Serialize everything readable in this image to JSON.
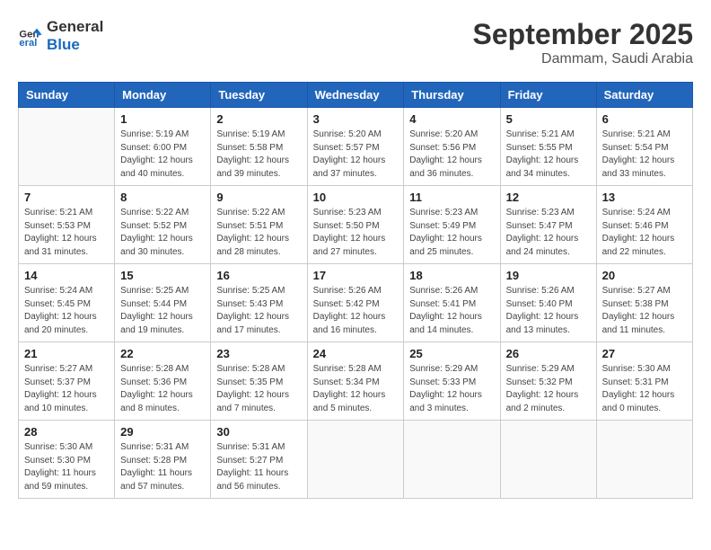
{
  "header": {
    "logo_line1": "General",
    "logo_line2": "Blue",
    "month": "September 2025",
    "location": "Dammam, Saudi Arabia"
  },
  "days_of_week": [
    "Sunday",
    "Monday",
    "Tuesday",
    "Wednesday",
    "Thursday",
    "Friday",
    "Saturday"
  ],
  "weeks": [
    [
      {
        "day": "",
        "info": ""
      },
      {
        "day": "1",
        "info": "Sunrise: 5:19 AM\nSunset: 6:00 PM\nDaylight: 12 hours\nand 40 minutes."
      },
      {
        "day": "2",
        "info": "Sunrise: 5:19 AM\nSunset: 5:58 PM\nDaylight: 12 hours\nand 39 minutes."
      },
      {
        "day": "3",
        "info": "Sunrise: 5:20 AM\nSunset: 5:57 PM\nDaylight: 12 hours\nand 37 minutes."
      },
      {
        "day": "4",
        "info": "Sunrise: 5:20 AM\nSunset: 5:56 PM\nDaylight: 12 hours\nand 36 minutes."
      },
      {
        "day": "5",
        "info": "Sunrise: 5:21 AM\nSunset: 5:55 PM\nDaylight: 12 hours\nand 34 minutes."
      },
      {
        "day": "6",
        "info": "Sunrise: 5:21 AM\nSunset: 5:54 PM\nDaylight: 12 hours\nand 33 minutes."
      }
    ],
    [
      {
        "day": "7",
        "info": "Sunrise: 5:21 AM\nSunset: 5:53 PM\nDaylight: 12 hours\nand 31 minutes."
      },
      {
        "day": "8",
        "info": "Sunrise: 5:22 AM\nSunset: 5:52 PM\nDaylight: 12 hours\nand 30 minutes."
      },
      {
        "day": "9",
        "info": "Sunrise: 5:22 AM\nSunset: 5:51 PM\nDaylight: 12 hours\nand 28 minutes."
      },
      {
        "day": "10",
        "info": "Sunrise: 5:23 AM\nSunset: 5:50 PM\nDaylight: 12 hours\nand 27 minutes."
      },
      {
        "day": "11",
        "info": "Sunrise: 5:23 AM\nSunset: 5:49 PM\nDaylight: 12 hours\nand 25 minutes."
      },
      {
        "day": "12",
        "info": "Sunrise: 5:23 AM\nSunset: 5:47 PM\nDaylight: 12 hours\nand 24 minutes."
      },
      {
        "day": "13",
        "info": "Sunrise: 5:24 AM\nSunset: 5:46 PM\nDaylight: 12 hours\nand 22 minutes."
      }
    ],
    [
      {
        "day": "14",
        "info": "Sunrise: 5:24 AM\nSunset: 5:45 PM\nDaylight: 12 hours\nand 20 minutes."
      },
      {
        "day": "15",
        "info": "Sunrise: 5:25 AM\nSunset: 5:44 PM\nDaylight: 12 hours\nand 19 minutes."
      },
      {
        "day": "16",
        "info": "Sunrise: 5:25 AM\nSunset: 5:43 PM\nDaylight: 12 hours\nand 17 minutes."
      },
      {
        "day": "17",
        "info": "Sunrise: 5:26 AM\nSunset: 5:42 PM\nDaylight: 12 hours\nand 16 minutes."
      },
      {
        "day": "18",
        "info": "Sunrise: 5:26 AM\nSunset: 5:41 PM\nDaylight: 12 hours\nand 14 minutes."
      },
      {
        "day": "19",
        "info": "Sunrise: 5:26 AM\nSunset: 5:40 PM\nDaylight: 12 hours\nand 13 minutes."
      },
      {
        "day": "20",
        "info": "Sunrise: 5:27 AM\nSunset: 5:38 PM\nDaylight: 12 hours\nand 11 minutes."
      }
    ],
    [
      {
        "day": "21",
        "info": "Sunrise: 5:27 AM\nSunset: 5:37 PM\nDaylight: 12 hours\nand 10 minutes."
      },
      {
        "day": "22",
        "info": "Sunrise: 5:28 AM\nSunset: 5:36 PM\nDaylight: 12 hours\nand 8 minutes."
      },
      {
        "day": "23",
        "info": "Sunrise: 5:28 AM\nSunset: 5:35 PM\nDaylight: 12 hours\nand 7 minutes."
      },
      {
        "day": "24",
        "info": "Sunrise: 5:28 AM\nSunset: 5:34 PM\nDaylight: 12 hours\nand 5 minutes."
      },
      {
        "day": "25",
        "info": "Sunrise: 5:29 AM\nSunset: 5:33 PM\nDaylight: 12 hours\nand 3 minutes."
      },
      {
        "day": "26",
        "info": "Sunrise: 5:29 AM\nSunset: 5:32 PM\nDaylight: 12 hours\nand 2 minutes."
      },
      {
        "day": "27",
        "info": "Sunrise: 5:30 AM\nSunset: 5:31 PM\nDaylight: 12 hours\nand 0 minutes."
      }
    ],
    [
      {
        "day": "28",
        "info": "Sunrise: 5:30 AM\nSunset: 5:30 PM\nDaylight: 11 hours\nand 59 minutes."
      },
      {
        "day": "29",
        "info": "Sunrise: 5:31 AM\nSunset: 5:28 PM\nDaylight: 11 hours\nand 57 minutes."
      },
      {
        "day": "30",
        "info": "Sunrise: 5:31 AM\nSunset: 5:27 PM\nDaylight: 11 hours\nand 56 minutes."
      },
      {
        "day": "",
        "info": ""
      },
      {
        "day": "",
        "info": ""
      },
      {
        "day": "",
        "info": ""
      },
      {
        "day": "",
        "info": ""
      }
    ]
  ]
}
